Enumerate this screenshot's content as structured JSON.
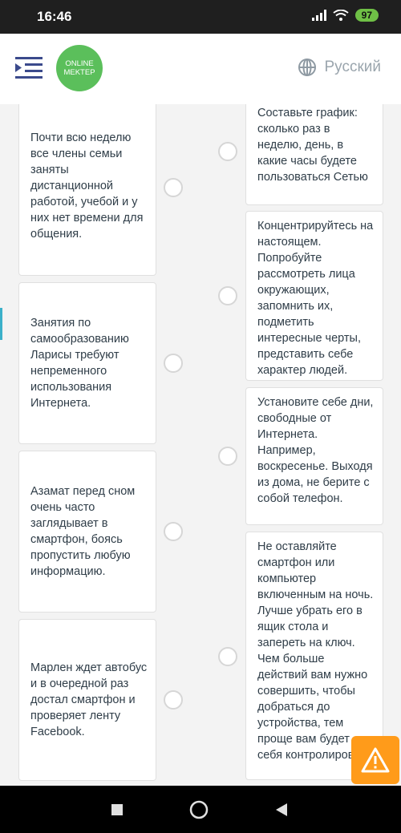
{
  "status": {
    "time": "16:46",
    "battery": "97"
  },
  "header": {
    "logo_line1": "ONLINE",
    "logo_line2": "MEKTEP",
    "language": "Русский"
  },
  "left_cards": [
    {
      "text": "Почти всю неделю все члены семьи заняты дистанционной работой, учебой и у них нет времени для общения."
    },
    {
      "text": "Занятия по самообразованию Ларисы требуют непременного использования Интернета."
    },
    {
      "text": "Азамат перед сном очень часто заглядывает в смартфон, боясь пропустить любую информацию."
    },
    {
      "text": "Марлен ждет автобус и в очередной раз достал смартфон и проверяет ленту Facebook."
    }
  ],
  "right_cards": [
    {
      "text": "Составьте график: сколько раз в неделю, день, в какие часы будете пользоваться Сетью"
    },
    {
      "text": "Концентрируйтесь на настоящем. Попробуйте рассмотреть лица окружающих, запомнить их, подметить интересные черты, представить себе характер людей."
    },
    {
      "text": "Установите себе дни, свободные от Интернета. Например, воскресенье. Выходя из дома, не берите с собой телефон."
    },
    {
      "text": "Не оставляйте смартфон или компьютер включенным на ночь. Лучше убрать его в ящик стола и запереть на ключ. Чем больше действий вам нужно совершить, чтобы добраться до устройства, тем проще вам будет себя контролировать"
    }
  ],
  "colors": {
    "accent": "#5bbf5b",
    "alert": "#ff9b1a",
    "text": "#2f3d48"
  },
  "icons": {
    "menu": "menu-icon",
    "globe": "globe-icon",
    "alert": "warning-icon"
  }
}
